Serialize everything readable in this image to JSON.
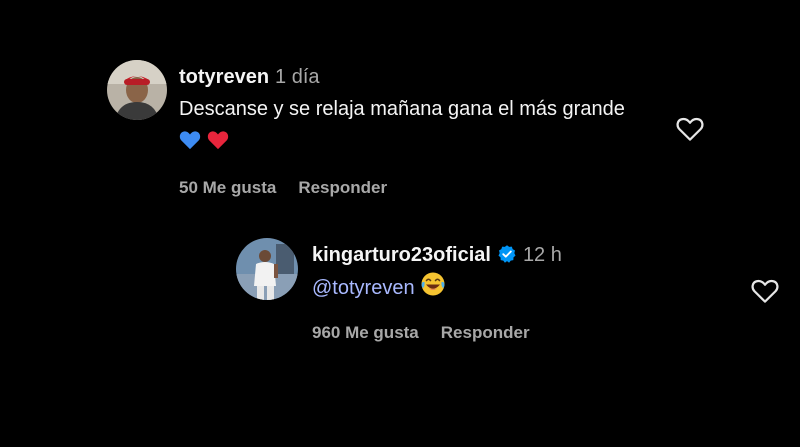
{
  "colors": {
    "background": "#000000",
    "text_primary": "#f5f5f5",
    "text_secondary": "#a8a8a8",
    "mention": "#a9b9ff",
    "verified_badge": "#0095f6",
    "blue_heart": "#3d8bf2",
    "red_heart": "#e8253c"
  },
  "comments": [
    {
      "username": "totyreven",
      "time": "1 día",
      "text": "Descanse y se relaja mañana gana el más grande",
      "emojis": [
        "blue-heart-icon",
        "red-heart-icon"
      ],
      "likes_label": "50 Me gusta",
      "reply_label": "Responder",
      "verified": false
    },
    {
      "username": "kingarturo23oficial",
      "time": "12 h",
      "mention": "@totyreven",
      "emojis": [
        "laughing-tears-icon"
      ],
      "likes_label": "960 Me gusta",
      "reply_label": "Responder",
      "verified": true
    }
  ]
}
